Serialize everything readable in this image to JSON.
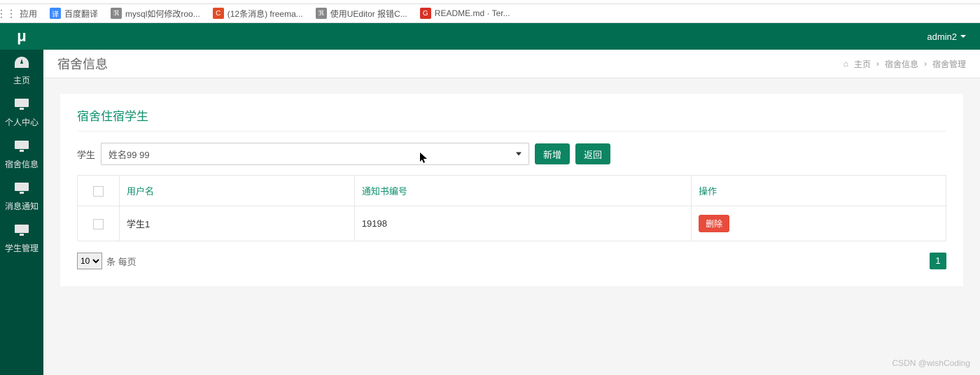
{
  "bookmarks": {
    "apps": "应用",
    "items": [
      {
        "label": "百度翻译",
        "color": "#3b8bff"
      },
      {
        "label": "mysql如何修改roo...",
        "color": "#777"
      },
      {
        "label": "(12条消息) freema...",
        "color": "#e34c26"
      },
      {
        "label": "使用UEditor 报错C...",
        "color": "#777"
      },
      {
        "label": "README.md · Ter...",
        "color": "#d93025"
      }
    ]
  },
  "header": {
    "logo": "μ",
    "user": "admin2"
  },
  "sidebar": {
    "items": [
      {
        "icon": "◔",
        "label": "主页"
      },
      {
        "icon": "🖥",
        "label": "个人中心"
      },
      {
        "icon": "🖥",
        "label": "宿舍信息"
      },
      {
        "icon": "🖥",
        "label": "消息通知"
      },
      {
        "icon": "🖥",
        "label": "学生管理"
      }
    ]
  },
  "page": {
    "title": "宿舍信息",
    "breadcrumb": {
      "home": "主页",
      "mid": "宿舍信息",
      "last": "宿舍管理"
    }
  },
  "panel": {
    "heading": "宿舍住宿学生",
    "filter_label": "学生",
    "student_selected": "姓名99 99",
    "add_label": "新增",
    "back_label": "返回"
  },
  "table": {
    "headers": {
      "username": "用户名",
      "notice_no": "通知书编号",
      "action": "操作"
    },
    "rows": [
      {
        "username": "学生1",
        "notice_no": "19198",
        "delete_label": "删除"
      }
    ]
  },
  "pager": {
    "size": "10",
    "label": "条 每页",
    "current": "1"
  },
  "watermark": "CSDN @wishCoding"
}
